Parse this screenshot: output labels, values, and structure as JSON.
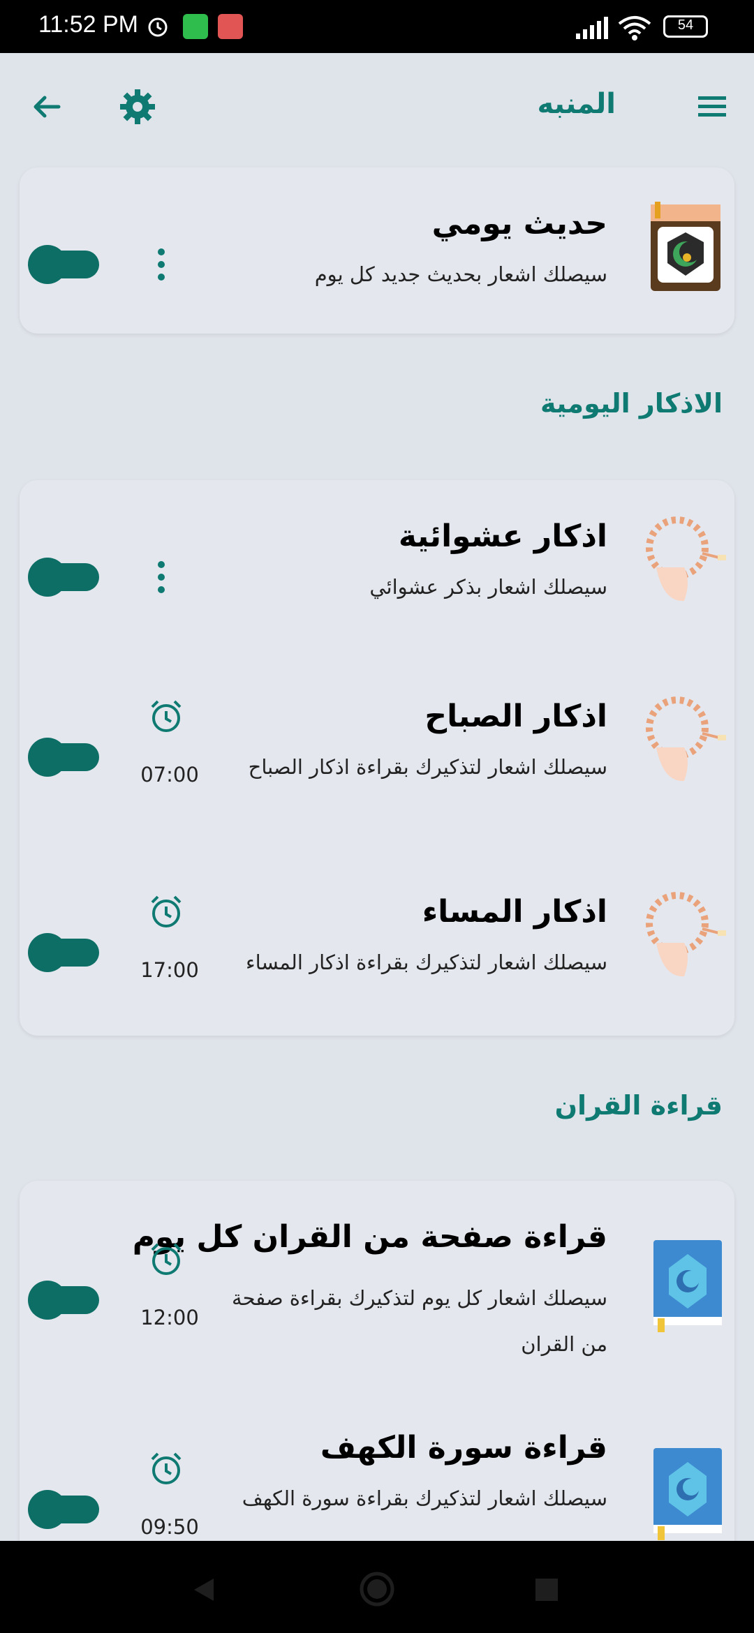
{
  "status_bar": {
    "time": "11:52 PM",
    "battery": "54"
  },
  "app_bar": {
    "title": "المنبه",
    "icons": [
      "menu-icon",
      "gear-icon",
      "back-arrow-icon"
    ]
  },
  "hadith_card": {
    "name": "حديث يومي",
    "desc": "سيصلك اشعار بحديث جديد كل يوم",
    "enabled": true
  },
  "azkar_section": {
    "title": "الاذكار اليومية",
    "items": [
      {
        "name": "اذكار عشوائية",
        "desc": "سيصلك اشعار بذكر عشوائي",
        "time": "",
        "enabled": true
      },
      {
        "name": "اذكار الصباح",
        "desc": "سيصلك اشعار لتذكيرك بقراءة اذكار الصباح",
        "time": "07:00",
        "enabled": true
      },
      {
        "name": "اذكار المساء",
        "desc": "سيصلك اشعار لتذكيرك بقراءة اذكار المساء",
        "time": "17:00",
        "enabled": true
      }
    ]
  },
  "quran_section": {
    "title": "قراءة القران",
    "items": [
      {
        "name": "قراءة صفحة من القران كل يوم",
        "desc": "سيصلك اشعار كل يوم لتذكيرك بقراءة صفحة من القران",
        "time": "12:00",
        "enabled": true
      },
      {
        "name": "قراءة سورة الكهف",
        "desc": "سيصلك اشعار لتذكيرك بقراءة سورة الكهف",
        "time": "09:50",
        "enabled": true
      }
    ]
  },
  "colors": {
    "accent": "#0e7a72",
    "toggle": "#0d6e66",
    "background": "#dfe3ea"
  }
}
